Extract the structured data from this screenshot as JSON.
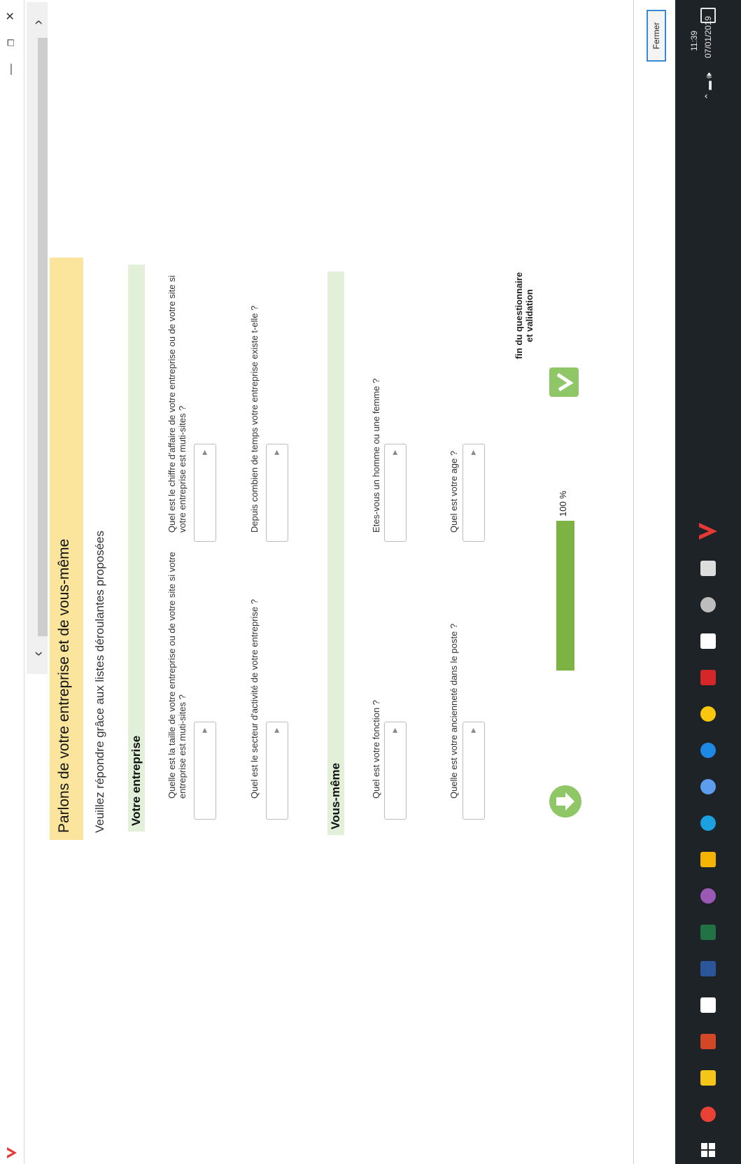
{
  "window": {
    "minimize_label": "—",
    "restore_label": "❐",
    "close_label": "✕",
    "close_button": "Fermer"
  },
  "scroll": {
    "left_arrow": "‹",
    "right_arrow": "›"
  },
  "page": {
    "title": "Parlons de votre entreprise et de vous-même",
    "subtitle": "Veuillez répondre grâce aux listes déroulantes proposées"
  },
  "sections": [
    {
      "title": "Votre entreprise",
      "questions": [
        "Quelle est la taille de votre entreprise ou de votre site si votre entreprise est muti-sites ?",
        "Quel est le chiffre d'affaire de votre entreprise ou de votre site si votre entreprise est muti-sites ?",
        "Quel est le secteur d'activité de votre entreprise ?",
        "Depuis combien de temps votre entreprise existe t-elle ?"
      ]
    },
    {
      "title": "Vous-même",
      "questions": [
        "Quel est votre fonction ?",
        "Etes-vous un homme ou une femme ?",
        "Quelle est votre ancienneté dans le poste ?",
        "Quel est votre age ?"
      ]
    }
  ],
  "progress": {
    "label": "100 %",
    "value": 1.0
  },
  "end": {
    "label_line1": "fin du questionnaire",
    "label_line2": "et validation"
  },
  "taskbar": {
    "time": "11:39",
    "date": "07/01/2019",
    "tray": "⌃ ▬ 🕪",
    "icons": [
      "windows-start",
      "chrome",
      "file-explorer",
      "powerpoint",
      "dropbox",
      "word",
      "excel",
      "paint",
      "store",
      "ie",
      "app-circle",
      "edge",
      "norton",
      "acrobat",
      "mail",
      "app-gray",
      "calendar",
      "app-v"
    ],
    "icon_colors": [
      "#ffffff",
      "#e94235",
      "#f5c518",
      "#d24726",
      "#ffffff",
      "#2b579a",
      "#217346",
      "#9b59b6",
      "#f4b400",
      "#1ba1e2",
      "#5c9ded",
      "#1e88e5",
      "#f9c80e",
      "#d62728",
      "#ffffff",
      "#bdbdbd",
      "#dddddd",
      "#e53935"
    ]
  },
  "colors": {
    "banner": "#fbe49c",
    "section": "#e2f0d9",
    "progress": "#7cb342",
    "button": "#8fc766"
  }
}
